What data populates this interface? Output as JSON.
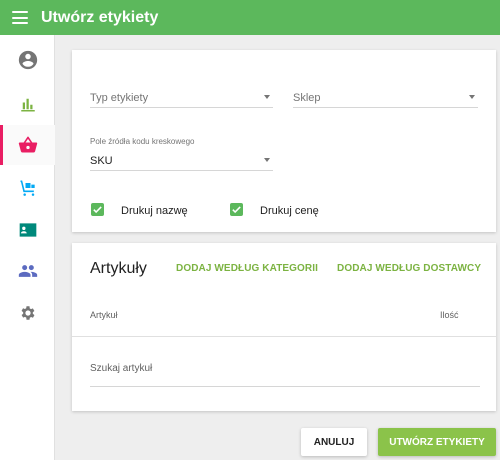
{
  "header": {
    "title": "Utwórz etykiety"
  },
  "sidebar": {
    "items": [
      {
        "icon": "account-circle-icon",
        "color": "#757575"
      },
      {
        "icon": "bar-chart-icon",
        "color": "#7cb342"
      },
      {
        "icon": "shopping-basket-icon",
        "color": "#e91e63",
        "active": true
      },
      {
        "icon": "hand-truck-icon",
        "color": "#03a9f4"
      },
      {
        "icon": "contact-card-icon",
        "color": "#00897b"
      },
      {
        "icon": "people-icon",
        "color": "#5c6bc0"
      },
      {
        "icon": "settings-icon",
        "color": "#757575"
      }
    ]
  },
  "form": {
    "label_type": {
      "placeholder": "Typ etykiety"
    },
    "store": {
      "placeholder": "Sklep"
    },
    "barcode_source": {
      "label": "Pole źródła kodu kreskowego",
      "value": "SKU"
    },
    "print_name": {
      "label": "Drukuj nazwę",
      "checked": true
    },
    "print_price": {
      "label": "Drukuj cenę",
      "checked": true
    }
  },
  "items": {
    "title": "Artykuły",
    "add_by_category": "DODAJ WEDŁUG KATEGORII",
    "add_by_supplier": "DODAJ WEDŁUG DOSTAWCY",
    "columns": {
      "item": "Artykuł",
      "quantity": "Ilość"
    },
    "search_placeholder": "Szukaj artykuł"
  },
  "actions": {
    "cancel": "ANULUJ",
    "create": "UTWÓRZ ETYKIETY"
  },
  "colors": {
    "appbar": "#5cb85c",
    "accent": "#8bc34a",
    "link": "#7cb342",
    "active_nav": "#e91e63"
  }
}
